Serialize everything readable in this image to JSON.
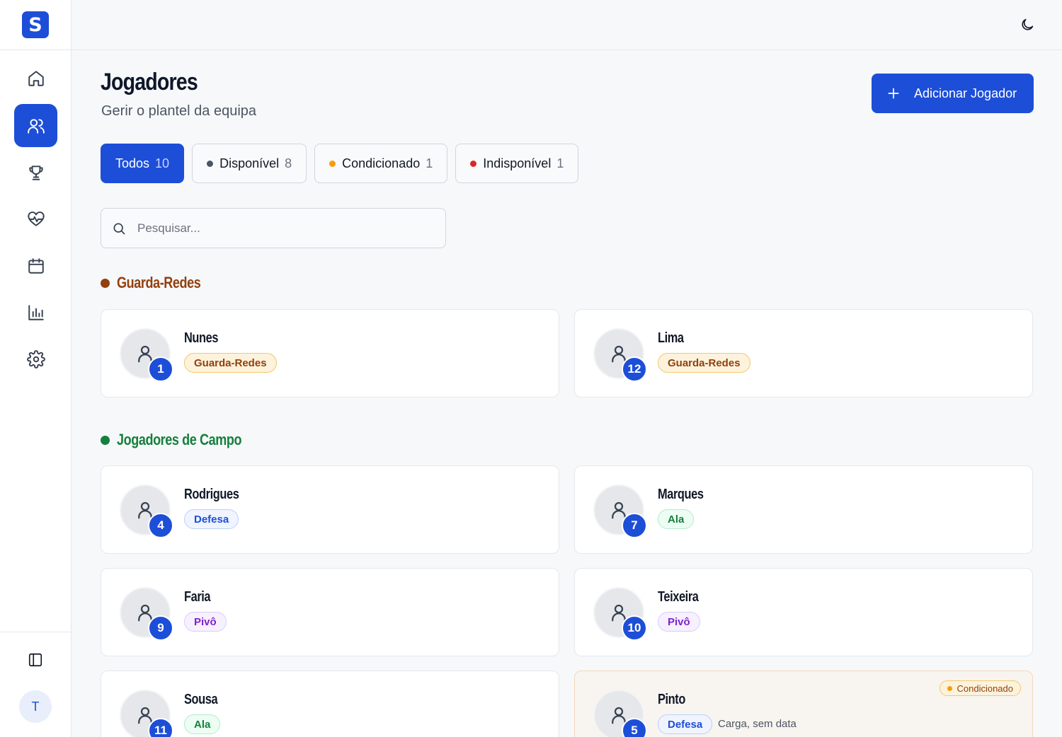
{
  "app": {
    "logo_letter": "S",
    "user_initial": "T"
  },
  "sidebar": {
    "items": [
      {
        "name": "home",
        "icon": "home-icon",
        "active": false
      },
      {
        "name": "players",
        "icon": "users-icon",
        "active": true
      },
      {
        "name": "competitions",
        "icon": "trophy-icon",
        "active": false
      },
      {
        "name": "health",
        "icon": "heart-pulse-icon",
        "active": false
      },
      {
        "name": "calendar",
        "icon": "calendar-icon",
        "active": false
      },
      {
        "name": "stats",
        "icon": "bar-chart-icon",
        "active": false
      },
      {
        "name": "settings",
        "icon": "gear-icon",
        "active": false
      }
    ]
  },
  "header": {
    "title": "Jogadores",
    "subtitle": "Gerir o plantel da equipa",
    "add_button": "Adicionar Jogador"
  },
  "filters": [
    {
      "label": "Todos",
      "count": "10",
      "active": true,
      "dot": ""
    },
    {
      "label": "Disponível",
      "count": "8",
      "active": false,
      "dot": "#4b5563"
    },
    {
      "label": "Condicionado",
      "count": "1",
      "active": false,
      "dot": "#f59e0b"
    },
    {
      "label": "Indisponível",
      "count": "1",
      "active": false,
      "dot": "#dc2626"
    }
  ],
  "search": {
    "placeholder": "Pesquisar..."
  },
  "sections": {
    "goalkeepers": {
      "label": "Guarda-Redes",
      "color": "#92400e"
    },
    "field": {
      "label": "Jogadores de Campo",
      "color": "#15803d"
    }
  },
  "players": [
    {
      "name": "Nunes",
      "number": "1",
      "position": "Guarda-Redes",
      "pos_class": "gk"
    },
    {
      "name": "Lima",
      "number": "12",
      "position": "Guarda-Redes",
      "pos_class": "gk"
    },
    {
      "name": "Rodrigues",
      "number": "4",
      "position": "Defesa",
      "pos_class": "def"
    },
    {
      "name": "Marques",
      "number": "7",
      "position": "Ala",
      "pos_class": "ala"
    },
    {
      "name": "Faria",
      "number": "9",
      "position": "Pivô",
      "pos_class": "piv"
    },
    {
      "name": "Teixeira",
      "number": "10",
      "position": "Pivô",
      "pos_class": "piv"
    },
    {
      "name": "Sousa",
      "number": "11",
      "position": "Ala",
      "pos_class": "ala"
    },
    {
      "name": "Pinto",
      "number": "5",
      "position": "Defesa",
      "pos_class": "def",
      "status": "Condicionado",
      "note": "Carga, sem data"
    }
  ]
}
